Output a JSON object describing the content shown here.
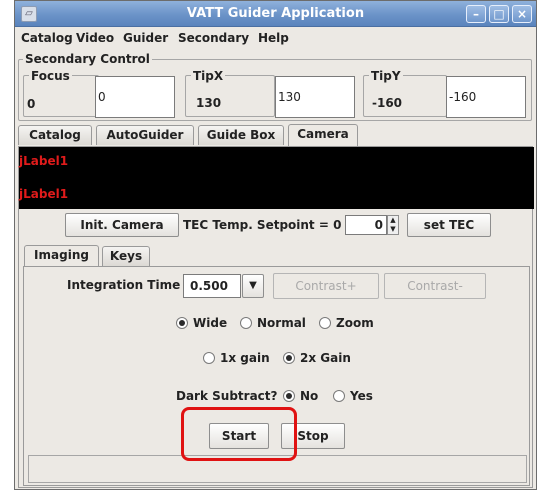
{
  "window": {
    "title": "VATT Guider Application"
  },
  "menu": [
    "Catalog",
    "Video",
    "Guider",
    "Secondary",
    "Help"
  ],
  "secondary_control": {
    "title": "Secondary Control",
    "focus": {
      "label": "Focus",
      "value": "0",
      "field": "0"
    },
    "tipx": {
      "label": "TipX",
      "value": "130",
      "field": "130"
    },
    "tipy": {
      "label": "TipY",
      "value": "-160",
      "field": "-160"
    }
  },
  "tabs": [
    "Catalog",
    "AutoGuider",
    "Guide Box",
    "Camera"
  ],
  "display": {
    "label1": "jLabel1",
    "label2": "jLabel1"
  },
  "camera": {
    "init_label": "Init. Camera",
    "tec_label": "TEC Temp. Setpoint = 0",
    "tec_value": "0",
    "set_tec_label": "set TEC"
  },
  "subtabs": [
    "Imaging",
    "Keys"
  ],
  "imaging": {
    "integration_label": "Integration Time",
    "integration_value": "0.500",
    "contrast_plus": "Contrast+",
    "contrast_minus": "Contrast-",
    "mode": [
      "Wide",
      "Normal",
      "Zoom"
    ],
    "gain": [
      "1x gain",
      "2x Gain"
    ],
    "dark_label": "Dark Subtract?",
    "dark": [
      "No",
      "Yes"
    ],
    "start": "Start",
    "stop": "Stop"
  },
  "icons": {
    "app": "app-icon",
    "minimize": "minimize-icon",
    "maximize": "maximize-icon",
    "close": "close-icon",
    "dropdown": "chevron-down-icon",
    "spinner": "spinner-arrows-icon"
  },
  "colors": {
    "title_bar": "#6b93c8",
    "panel": "#ece9e4",
    "debug_label": "#e01b1b",
    "highlight": "#e01212"
  }
}
